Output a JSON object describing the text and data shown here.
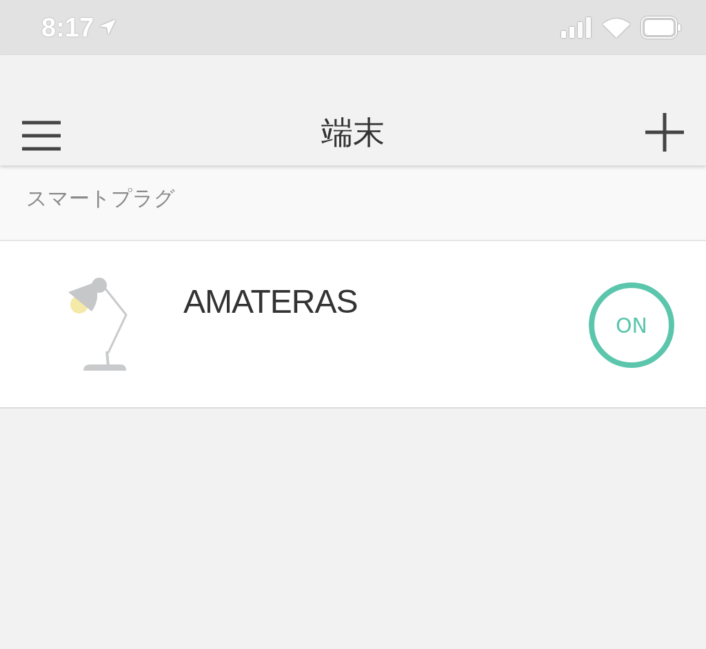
{
  "status_bar": {
    "time": "8:17"
  },
  "nav_bar": {
    "title": "端末"
  },
  "section": {
    "title": "スマートプラグ"
  },
  "devices": [
    {
      "name": "AMATERAS",
      "on": true,
      "toggle_label": "ON"
    }
  ]
}
